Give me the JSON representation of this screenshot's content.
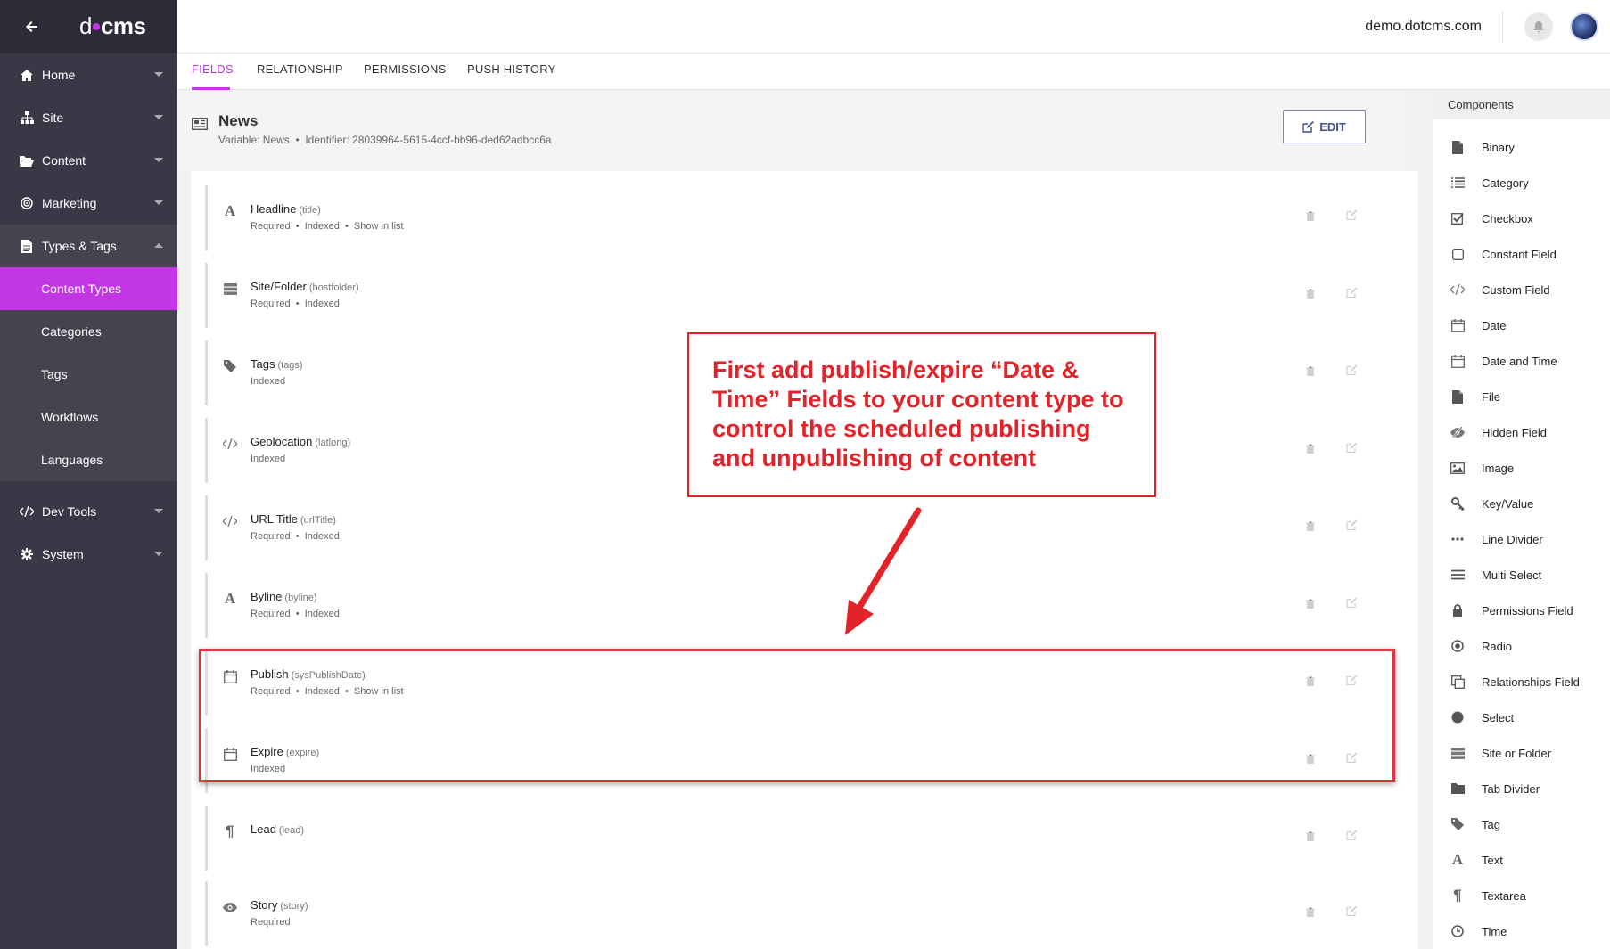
{
  "sidebar": {
    "logo_left": "d",
    "logo_right": "cms",
    "items": [
      {
        "label": "Home",
        "icon": "home-icon"
      },
      {
        "label": "Site",
        "icon": "sitemap-icon"
      },
      {
        "label": "Content",
        "icon": "folder-open-icon"
      },
      {
        "label": "Marketing",
        "icon": "bullseye-icon"
      },
      {
        "label": "Types & Tags",
        "icon": "file-icon"
      }
    ],
    "sub_items": [
      {
        "label": "Content Types",
        "active": true
      },
      {
        "label": "Categories"
      },
      {
        "label": "Tags"
      },
      {
        "label": "Workflows"
      },
      {
        "label": "Languages"
      }
    ],
    "lower_items": [
      {
        "label": "Dev Tools",
        "icon": "code-icon"
      },
      {
        "label": "System",
        "icon": "gear-icon"
      }
    ]
  },
  "topbar": {
    "host": "demo.dotcms.com"
  },
  "tabs": [
    "FIELDS",
    "RELATIONSHIP",
    "PERMISSIONS",
    "PUSH HISTORY"
  ],
  "content_type": {
    "title": "News",
    "meta": "Variable: News  •  Identifier: 28039964-5615-4ccf-bb96-ded62adbcc6a",
    "edit_label": "EDIT"
  },
  "fields": [
    {
      "name": "Headline",
      "var": "(title)",
      "meta": "Required  •  Indexed  •  Show in list",
      "icon": "text-icon"
    },
    {
      "name": "Site/Folder",
      "var": "(hostfolder)",
      "meta": "Required  •  Indexed",
      "icon": "server-icon"
    },
    {
      "name": "Tags",
      "var": "(tags)",
      "meta": "Indexed",
      "icon": "tag-icon"
    },
    {
      "name": "Geolocation",
      "var": "(latlong)",
      "meta": "Indexed",
      "icon": "code-icon"
    },
    {
      "name": "URL Title",
      "var": "(urlTitle)",
      "meta": "Required  •  Indexed",
      "icon": "code-icon"
    },
    {
      "name": "Byline",
      "var": "(byline)",
      "meta": "Required  •  Indexed",
      "icon": "text-icon"
    },
    {
      "name": "Publish",
      "var": "(sysPublishDate)",
      "meta": "Required  •  Indexed  •  Show in list",
      "icon": "calendar-icon"
    },
    {
      "name": "Expire",
      "var": "(expire)",
      "meta": "Indexed",
      "icon": "calendar-icon"
    },
    {
      "name": "Lead",
      "var": "(lead)",
      "meta": "",
      "icon": "paragraph-icon"
    },
    {
      "name": "Story",
      "var": "(story)",
      "meta": "Required",
      "icon": "eye-icon"
    }
  ],
  "components": {
    "title": "Components",
    "items": [
      {
        "label": "Binary",
        "icon": "file-icon"
      },
      {
        "label": "Category",
        "icon": "list-icon"
      },
      {
        "label": "Checkbox",
        "icon": "checkbox-icon"
      },
      {
        "label": "Constant Field",
        "icon": "square-icon"
      },
      {
        "label": "Custom Field",
        "icon": "code-icon"
      },
      {
        "label": "Date",
        "icon": "calendar-icon"
      },
      {
        "label": "Date and Time",
        "icon": "calendar-icon"
      },
      {
        "label": "File",
        "icon": "file-icon"
      },
      {
        "label": "Hidden Field",
        "icon": "eye-slash-icon"
      },
      {
        "label": "Image",
        "icon": "image-icon"
      },
      {
        "label": "Key/Value",
        "icon": "key-icon"
      },
      {
        "label": "Line Divider",
        "icon": "ellipsis-icon"
      },
      {
        "label": "Multi Select",
        "icon": "bars-icon"
      },
      {
        "label": "Permissions Field",
        "icon": "lock-icon"
      },
      {
        "label": "Radio",
        "icon": "radio-icon"
      },
      {
        "label": "Relationships Field",
        "icon": "clone-icon"
      },
      {
        "label": "Select",
        "icon": "circle-icon"
      },
      {
        "label": "Site or Folder",
        "icon": "server-icon"
      },
      {
        "label": "Tab Divider",
        "icon": "folder-icon"
      },
      {
        "label": "Tag",
        "icon": "tag-icon"
      },
      {
        "label": "Text",
        "icon": "text-icon"
      },
      {
        "label": "Textarea",
        "icon": "paragraph-icon"
      },
      {
        "label": "Time",
        "icon": "clock-icon"
      }
    ]
  },
  "annotation": {
    "text": "First add publish/expire “Date & Time” Fields to your content type to control the scheduled publishing and  unpublishing of content",
    "color": "#e2232a"
  },
  "colors": {
    "accent": "#c336e5",
    "sidebar": "#3a3847"
  }
}
